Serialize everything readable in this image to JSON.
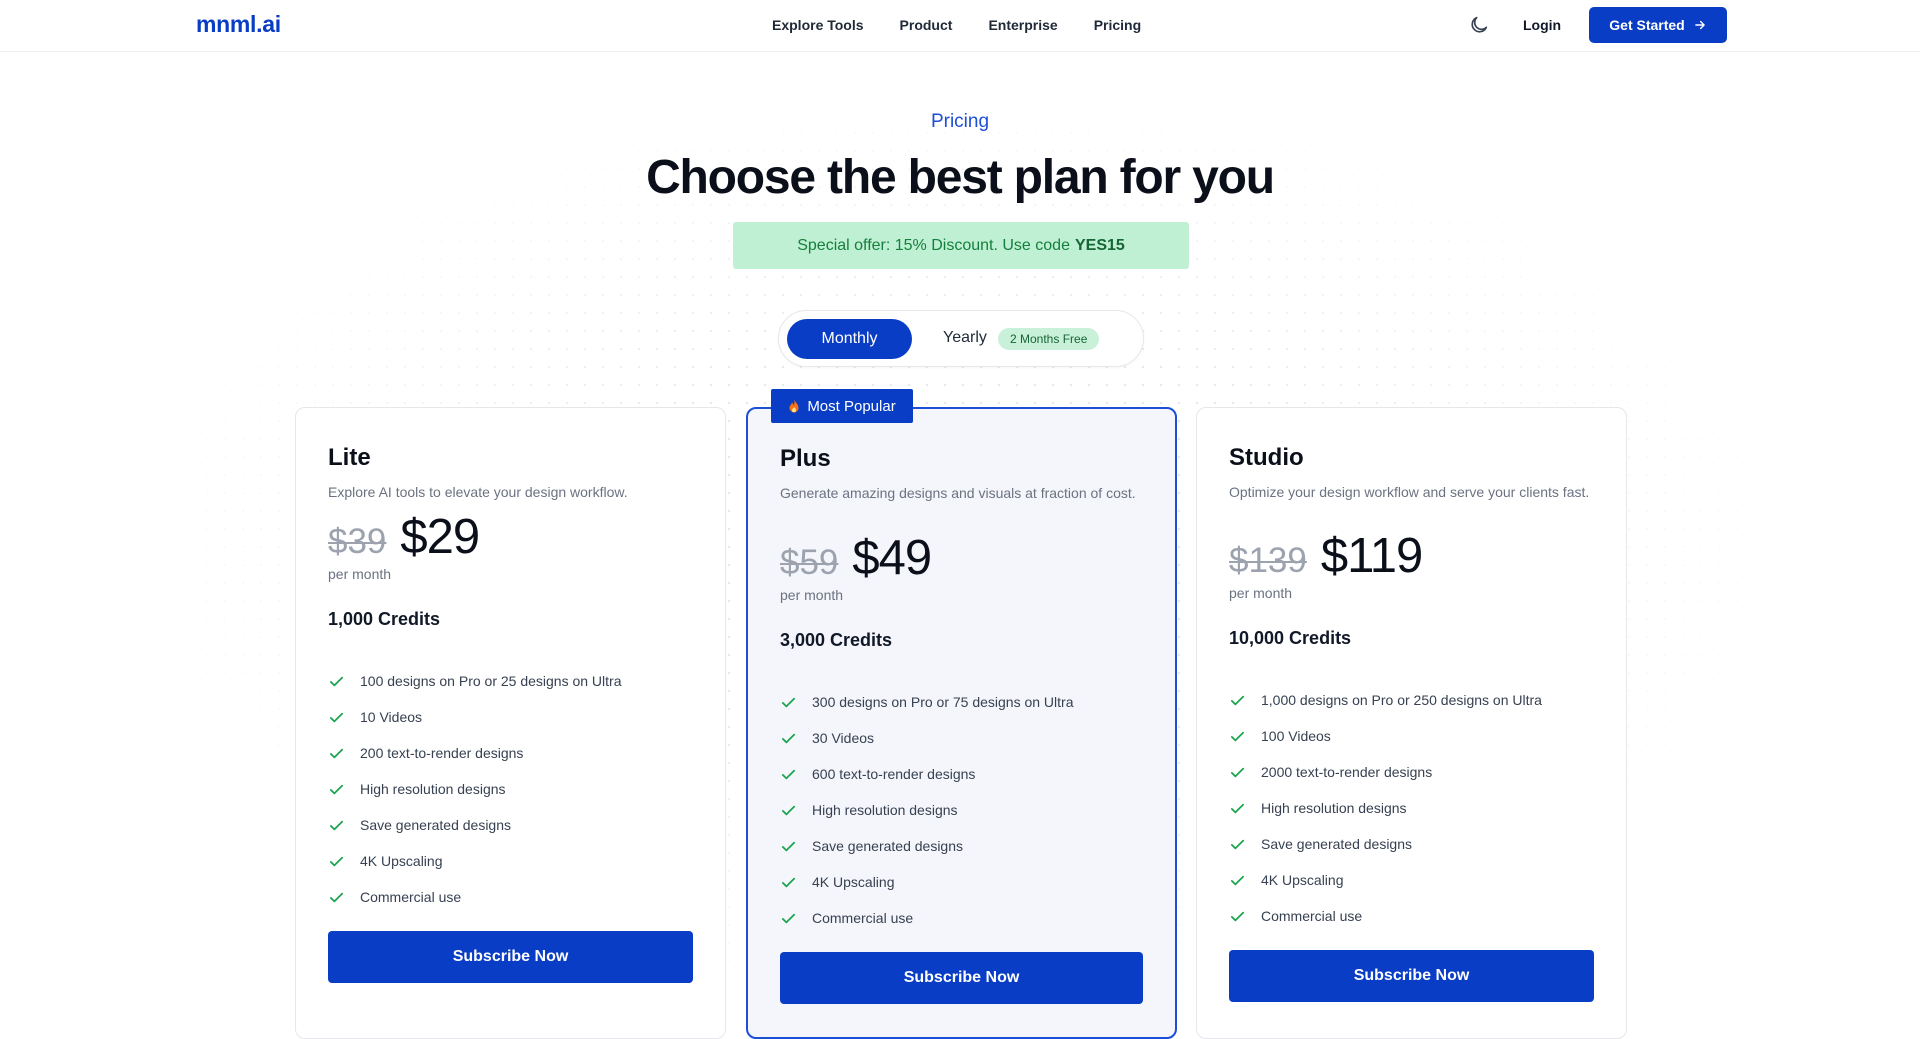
{
  "header": {
    "logo": "mnml.ai",
    "nav": [
      "Explore Tools",
      "Product",
      "Enterprise",
      "Pricing"
    ],
    "login": "Login",
    "get_started": "Get Started"
  },
  "hero": {
    "eyebrow": "Pricing",
    "title": "Choose the best plan for you",
    "offer_text": "Special offer: 15% Discount. Use code",
    "offer_code": "YES15"
  },
  "billing_toggle": {
    "monthly": "Monthly",
    "yearly": "Yearly",
    "yearly_badge": "2 Months Free",
    "selected": "Monthly"
  },
  "popular_badge": "Most Popular",
  "plans": [
    {
      "name": "Lite",
      "description": "Explore AI tools to elevate your design workflow.",
      "old_price": "$39",
      "price": "$29",
      "period": "per month",
      "credits": "1,000 Credits",
      "features": [
        "100 designs on Pro or 25 designs on Ultra",
        "10 Videos",
        "200 text-to-render designs",
        "High resolution designs",
        "Save generated designs",
        "4K Upscaling",
        "Commercial use"
      ],
      "cta": "Subscribe Now"
    },
    {
      "name": "Plus",
      "description": "Generate amazing designs and visuals at fraction of cost.",
      "old_price": "$59",
      "price": "$49",
      "period": "per month",
      "credits": "3,000 Credits",
      "features": [
        "300 designs on Pro or 75 designs on Ultra",
        "30 Videos",
        "600 text-to-render designs",
        "High resolution designs",
        "Save generated designs",
        "4K Upscaling",
        "Commercial use"
      ],
      "cta": "Subscribe Now"
    },
    {
      "name": "Studio",
      "description": "Optimize your design workflow and serve your clients fast.",
      "old_price": "$139",
      "price": "$119",
      "period": "per month",
      "credits": "10,000 Credits",
      "features": [
        "1,000 designs on Pro or 250 designs on Ultra",
        "100 Videos",
        "2000 text-to-render designs",
        "High resolution designs",
        "Save generated designs",
        "4K Upscaling",
        "Commercial use"
      ],
      "cta": "Subscribe Now"
    }
  ],
  "colors": {
    "brand": "#0a3dc6",
    "offer_bg": "#bff0d3",
    "check": "#16a34a"
  }
}
